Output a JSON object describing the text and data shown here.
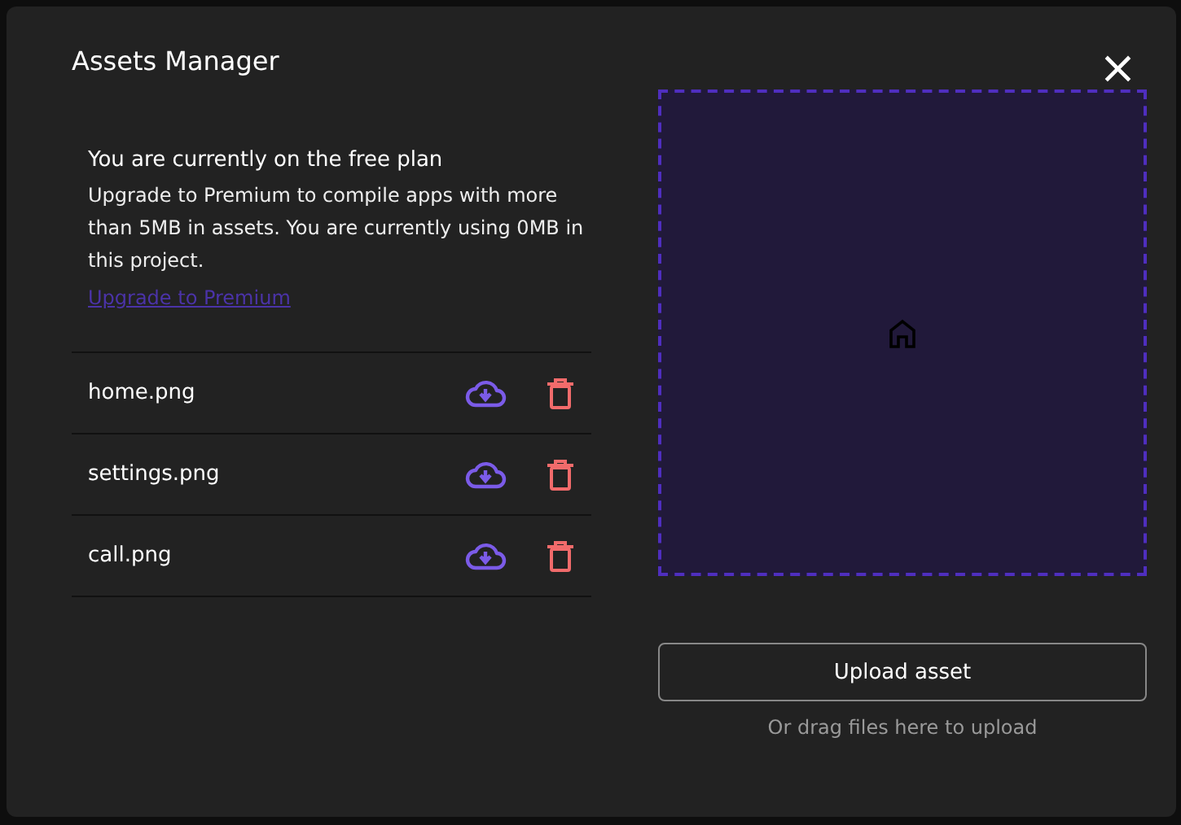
{
  "dialog": {
    "title": "Assets Manager",
    "close": "×"
  },
  "plan": {
    "heading": "You are currently on the free plan",
    "text": "Upgrade to Premium to compile apps with more than 5MB in assets. You are currently using 0MB in this project.",
    "link": "Upgrade to Premium"
  },
  "assets": [
    {
      "name": "home.png"
    },
    {
      "name": "settings.png"
    },
    {
      "name": "call.png"
    }
  ],
  "upload": {
    "button": "Upload asset",
    "hint": "Or drag files here to upload"
  }
}
